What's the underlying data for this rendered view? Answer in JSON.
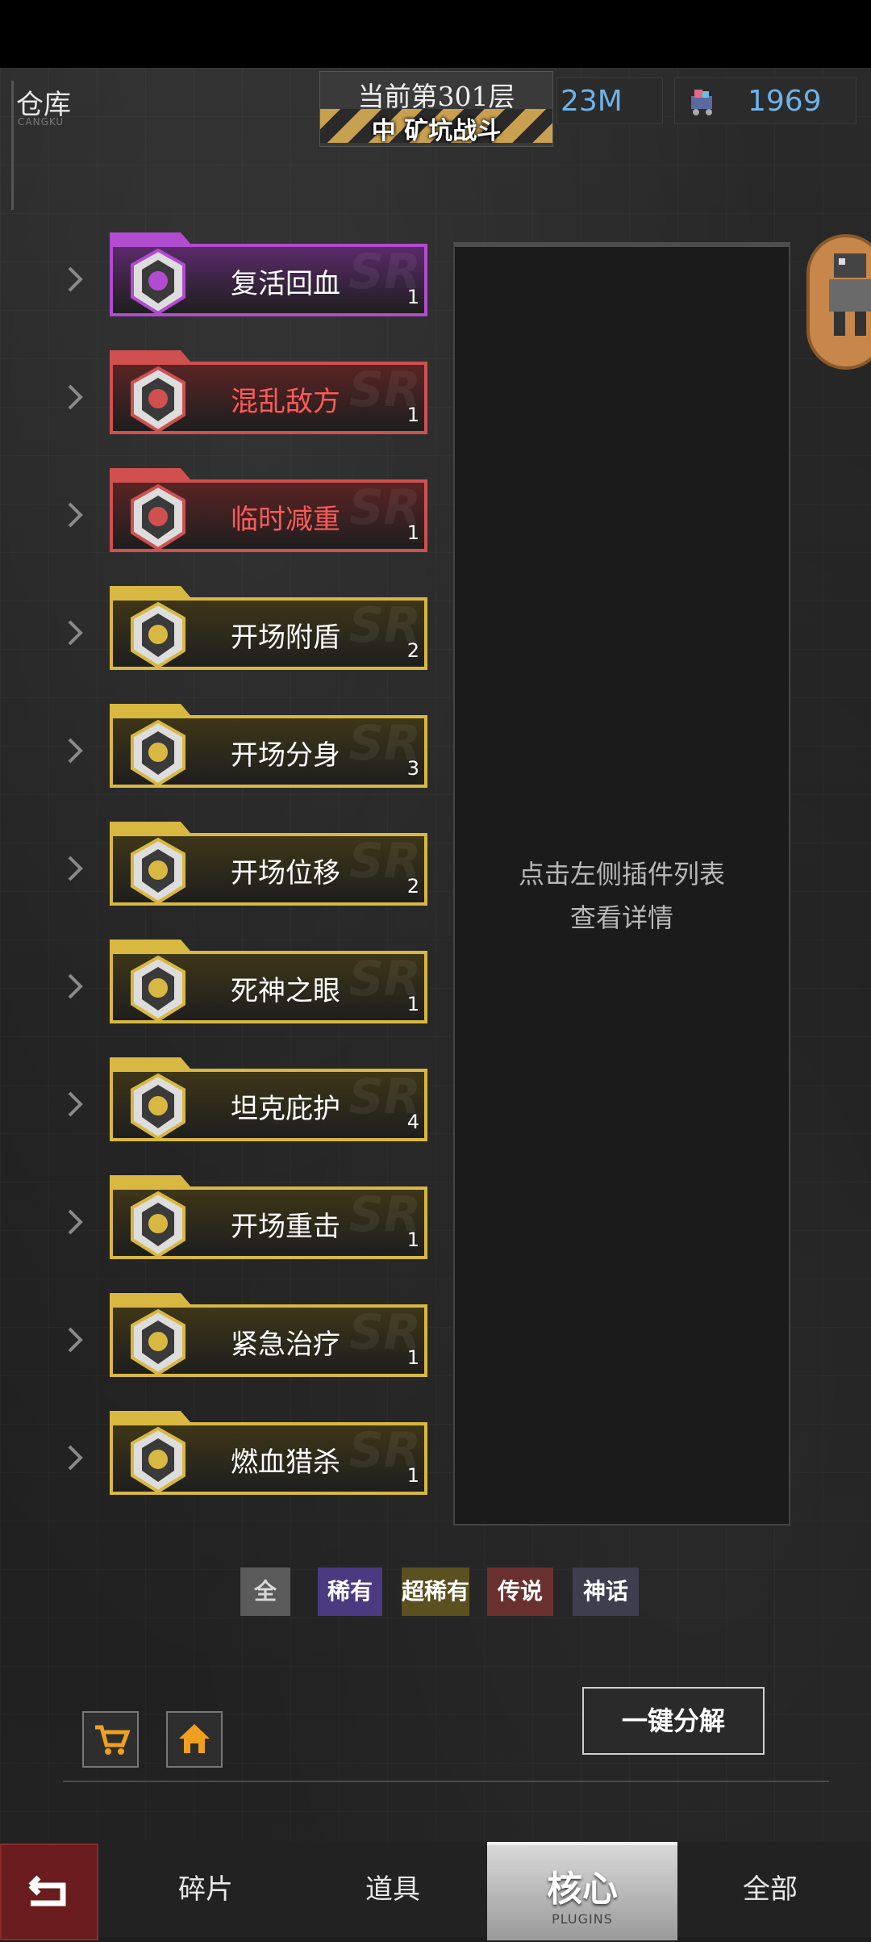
{
  "header": {
    "title": "仓库",
    "subtitle": "CANGKU",
    "floor_line1": "当前第301层",
    "floor_line2": "中  矿坑战斗",
    "resource1_value": "23M",
    "resource2_value": "1969",
    "resource1_icon": "currency-icon",
    "resource2_icon": "gem-cart-icon"
  },
  "items": [
    {
      "name": "复活回血",
      "count": "1",
      "rarity": "mythic",
      "name_color": "#ffffff",
      "frame": "#b14bd0",
      "bg": "#5a2a6a"
    },
    {
      "name": "混乱敌方",
      "count": "1",
      "rarity": "legend",
      "name_color": "#ff5a5a",
      "frame": "#d05050",
      "bg": "#5a2424"
    },
    {
      "name": "临时减重",
      "count": "1",
      "rarity": "legend",
      "name_color": "#ff5a5a",
      "frame": "#d05050",
      "bg": "#5a2424"
    },
    {
      "name": "开场附盾",
      "count": "2",
      "rarity": "super-rare",
      "name_color": "#ffffff",
      "frame": "#d8b840",
      "bg": "#3e3618"
    },
    {
      "name": "开场分身",
      "count": "3",
      "rarity": "super-rare",
      "name_color": "#ffffff",
      "frame": "#d8b840",
      "bg": "#3e3618"
    },
    {
      "name": "开场位移",
      "count": "2",
      "rarity": "super-rare",
      "name_color": "#ffffff",
      "frame": "#d8b840",
      "bg": "#3e3618"
    },
    {
      "name": "死神之眼",
      "count": "1",
      "rarity": "super-rare",
      "name_color": "#ffffff",
      "frame": "#d8b840",
      "bg": "#3e3618"
    },
    {
      "name": "坦克庇护",
      "count": "4",
      "rarity": "super-rare",
      "name_color": "#ffffff",
      "frame": "#d8b840",
      "bg": "#3e3618"
    },
    {
      "name": "开场重击",
      "count": "1",
      "rarity": "super-rare",
      "name_color": "#ffffff",
      "frame": "#d8b840",
      "bg": "#3e3618"
    },
    {
      "name": "紧急治疗",
      "count": "1",
      "rarity": "super-rare",
      "name_color": "#ffffff",
      "frame": "#d8b840",
      "bg": "#3e3618"
    },
    {
      "name": "燃血猎杀",
      "count": "1",
      "rarity": "super-rare",
      "name_color": "#ffffff",
      "frame": "#d8b840",
      "bg": "#3e3618"
    }
  ],
  "detail": {
    "hint_line1": "点击左侧插件列表",
    "hint_line2": "查看详情"
  },
  "filters": [
    {
      "label": "全",
      "color": "#d8d8d8",
      "bg": "#5a5a5a"
    },
    {
      "label": "稀有",
      "color": "#ffffff",
      "bg": "#4a3a80"
    },
    {
      "label": "超稀有",
      "color": "#ffffff",
      "bg": "#5a5020"
    },
    {
      "label": "传说",
      "color": "#ffffff",
      "bg": "#6a3030"
    },
    {
      "label": "神话",
      "color": "#ffffff",
      "bg": "#3e3e4e"
    }
  ],
  "bottom": {
    "shop_icon": "cart-icon",
    "home_icon": "home-icon",
    "decompose_label": "一键分解"
  },
  "tabs": {
    "tab1": "碎片",
    "tab2": "道具",
    "tab3": "核心",
    "tab3_sub": "PLUGINS",
    "tab4": "全部",
    "back_icon": "back-icon"
  }
}
